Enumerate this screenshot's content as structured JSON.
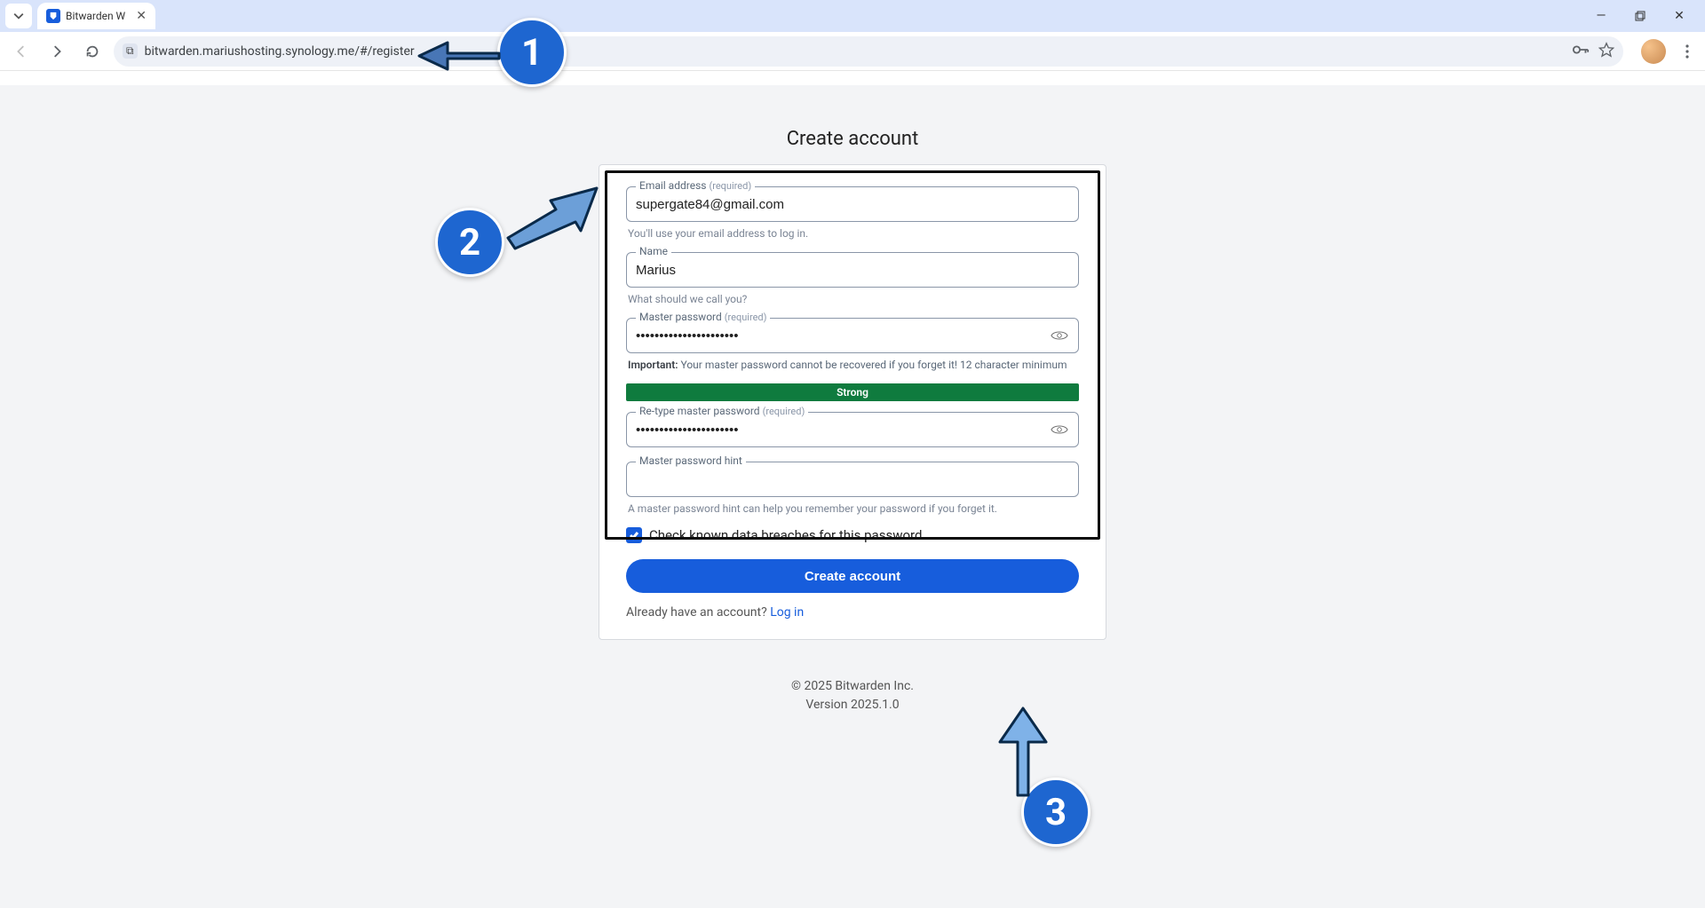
{
  "browser": {
    "tab_title": "Bitwarden W",
    "address": "bitwarden.mariushosting.synology.me/#/register",
    "site_chip": "⧉"
  },
  "page": {
    "title": "Create account",
    "email": {
      "label": "Email address",
      "required": "(required)",
      "value": "supergate84@gmail.com",
      "helper": "You'll use your email address to log in."
    },
    "name": {
      "label": "Name",
      "value": "Marius",
      "helper": "What should we call you?"
    },
    "master_password": {
      "label": "Master password",
      "required": "(required)",
      "value": "••••••••••••••••••••••",
      "helper_prefix": "Important:",
      "helper_rest": " Your master password cannot be recovered if you forget it! 12 character minimum"
    },
    "strength": {
      "label": "Strong",
      "color": "#0f7b3e"
    },
    "retype": {
      "label": "Re-type master password",
      "required": "(required)",
      "value": "••••••••••••••••••••••"
    },
    "hint": {
      "label": "Master password hint",
      "value": "",
      "helper": "A master password hint can help you remember your password if you forget it."
    },
    "breach_checkbox": {
      "checked": true,
      "label": "Check known data breaches for this password"
    },
    "create_button": "Create account",
    "login_prompt": "Already have an account? ",
    "login_link": "Log in",
    "footer_line1": "© 2025 Bitwarden Inc.",
    "footer_line2": "Version 2025.1.0"
  },
  "annotations": {
    "n1": "1",
    "n2": "2",
    "n3": "3"
  }
}
